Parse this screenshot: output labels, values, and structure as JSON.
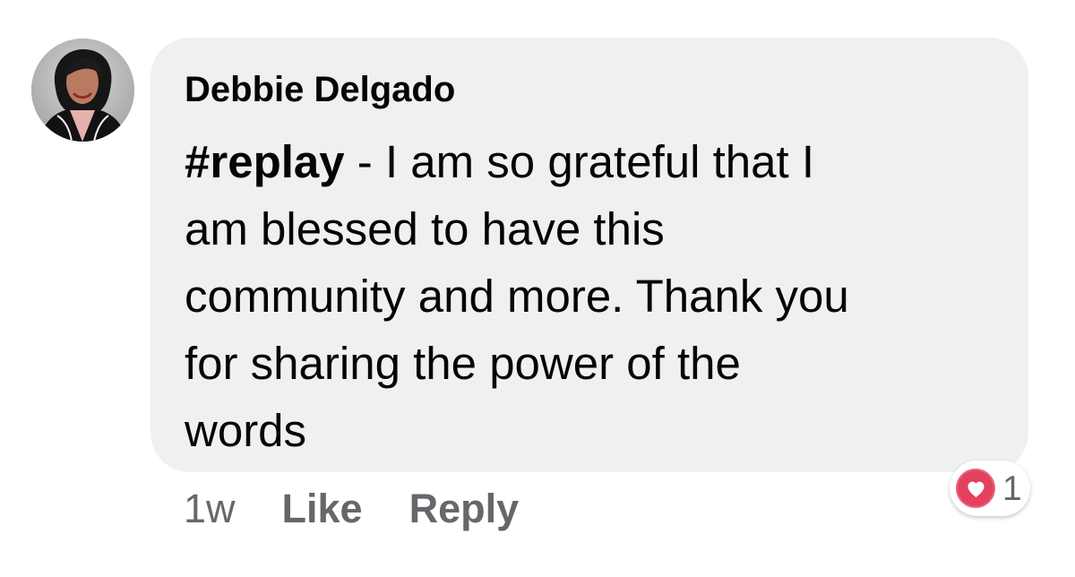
{
  "comment": {
    "author": "Debbie Delgado",
    "hashtag": "#replay",
    "text": " - I am so grateful that I\nam blessed to have this\ncommunity and more.  Thank you\nfor sharing the power of the\nwords"
  },
  "meta": {
    "timestamp": "1w",
    "like_label": "Like",
    "reply_label": "Reply"
  },
  "reactions": {
    "icon": "heart-icon",
    "count": "1",
    "color": "#e4405f"
  },
  "colors": {
    "bubble": "#eff0f2",
    "meta_text": "#65676b",
    "primary_text": "#050505"
  }
}
